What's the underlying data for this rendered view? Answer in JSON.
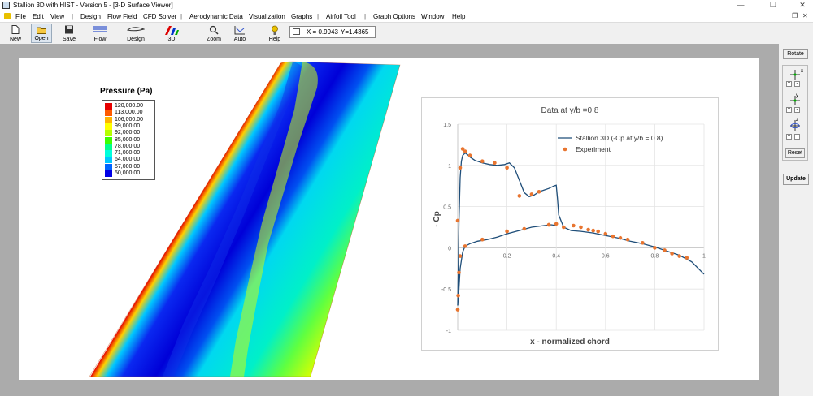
{
  "window": {
    "title": "Stallion 3D with HIST - Version 5 - [3-D Surface Viewer]",
    "minimize": "—",
    "maximize": "❐",
    "close": "✕"
  },
  "menu": {
    "items": [
      "File",
      "Edit",
      "View",
      "Design",
      "Flow Field",
      "CFD Solver",
      "Aerodynamic Data",
      "Visualization",
      "Graphs",
      "Airfoil Tool",
      "Graph Options",
      "Window",
      "Help"
    ],
    "mdi_minimize": "_",
    "mdi_restore": "❐",
    "mdi_close": "✕"
  },
  "toolbar": {
    "new": "New",
    "open": "Open",
    "save": "Save",
    "flow": "Flow",
    "design": "Design",
    "three_d": "3D",
    "zoom": "Zoom",
    "auto": "Auto",
    "help": "Help",
    "coords": {
      "x": "X = 0.9943",
      "y": "Y=1.4365"
    }
  },
  "right_panel": {
    "rotate": "Rotate",
    "reset": "Reset",
    "update": "Update",
    "axis_x": "x",
    "axis_y": "y",
    "axis_z": "z",
    "plus": "+",
    "minus": "-"
  },
  "legend": {
    "title": "Pressure (Pa)",
    "entries": [
      {
        "label": "120,000.00",
        "color": "#e60000"
      },
      {
        "label": "113,000.00",
        "color": "#ff5a00"
      },
      {
        "label": "106,000.00",
        "color": "#ffb400"
      },
      {
        "label": "99,000.00",
        "color": "#ffff00"
      },
      {
        "label": "92,000.00",
        "color": "#b4ff00"
      },
      {
        "label": "85,000.00",
        "color": "#3cff00"
      },
      {
        "label": "78,000.00",
        "color": "#00ff8c"
      },
      {
        "label": "71,000.00",
        "color": "#00ffdc"
      },
      {
        "label": "64,000.00",
        "color": "#00c8ff"
      },
      {
        "label": "57,000.00",
        "color": "#0064ff"
      },
      {
        "label": "50,000.00",
        "color": "#0000e6"
      }
    ]
  },
  "chart_data": {
    "type": "line",
    "title": "Data at  y/b =0.8",
    "xlabel": "x - normalized chord",
    "ylabel": "- Cp",
    "xlim": [
      0,
      1
    ],
    "ylim": [
      -1,
      1.5
    ],
    "xticks": [
      "0.2",
      "0.4",
      "0.6",
      "0.8",
      "1"
    ],
    "yticks": [
      "1.5",
      "1",
      "0.5",
      "0",
      "-0.5",
      "-1"
    ],
    "grid": true,
    "legend_position": "top-right",
    "series": [
      {
        "name": "Stallion 3D (-Cp at y/b = 0.8)",
        "color": "#1f4e79",
        "style": "line",
        "x": [
          0.0,
          0.002,
          0.005,
          0.01,
          0.015,
          0.02,
          0.03,
          0.04,
          0.05,
          0.07,
          0.1,
          0.13,
          0.16,
          0.19,
          0.21,
          0.23,
          0.25,
          0.27,
          0.29,
          0.31,
          0.33,
          0.35,
          0.37,
          0.39,
          0.4,
          0.405,
          0.41,
          0.43,
          0.46,
          0.5,
          0.55,
          0.6,
          0.65,
          0.7,
          0.75,
          0.8,
          0.85,
          0.9,
          0.95,
          1.0
        ],
        "y": [
          -0.7,
          -0.3,
          0.3,
          0.85,
          1.05,
          1.12,
          1.15,
          1.13,
          1.1,
          1.06,
          1.03,
          1.01,
          1.0,
          1.01,
          1.03,
          0.97,
          0.82,
          0.67,
          0.62,
          0.64,
          0.68,
          0.7,
          0.72,
          0.75,
          0.76,
          0.6,
          0.4,
          0.25,
          0.21,
          0.2,
          0.18,
          0.15,
          0.12,
          0.08,
          0.05,
          0.01,
          -0.04,
          -0.09,
          -0.17,
          -0.32
        ]
      },
      {
        "name": "",
        "color": "#1f4e79",
        "style": "line",
        "x": [
          0.0,
          0.005,
          0.01,
          0.02,
          0.03,
          0.05,
          0.08,
          0.12,
          0.16,
          0.2,
          0.25,
          0.3,
          0.35,
          0.38,
          0.4
        ],
        "y": [
          -0.7,
          -0.5,
          -0.25,
          -0.05,
          0.02,
          0.05,
          0.08,
          0.1,
          0.13,
          0.17,
          0.21,
          0.25,
          0.27,
          0.28,
          0.27
        ]
      },
      {
        "name": "Experiment",
        "color": "#e87530",
        "style": "scatter",
        "x": [
          0.0,
          0.002,
          0.005,
          0.01,
          0.02,
          0.03,
          0.05,
          0.1,
          0.15,
          0.2,
          0.25,
          0.3,
          0.33,
          0.37,
          0.0,
          0.01,
          0.03,
          0.1,
          0.2,
          0.27,
          0.37,
          0.4,
          0.43,
          0.47,
          0.5,
          0.53,
          0.55,
          0.57,
          0.6,
          0.63,
          0.66,
          0.69,
          0.75,
          0.8,
          0.84,
          0.87,
          0.9,
          0.93
        ],
        "y": [
          -0.75,
          -0.58,
          -0.3,
          0.97,
          1.2,
          1.17,
          1.12,
          1.05,
          1.03,
          0.97,
          0.63,
          0.65,
          0.68,
          0.28,
          0.33,
          -0.1,
          0.02,
          0.1,
          0.2,
          0.23,
          0.28,
          0.29,
          0.25,
          0.27,
          0.25,
          0.22,
          0.21,
          0.2,
          0.17,
          0.14,
          0.12,
          0.1,
          0.06,
          0.0,
          -0.03,
          -0.07,
          -0.1,
          -0.12
        ]
      }
    ]
  }
}
